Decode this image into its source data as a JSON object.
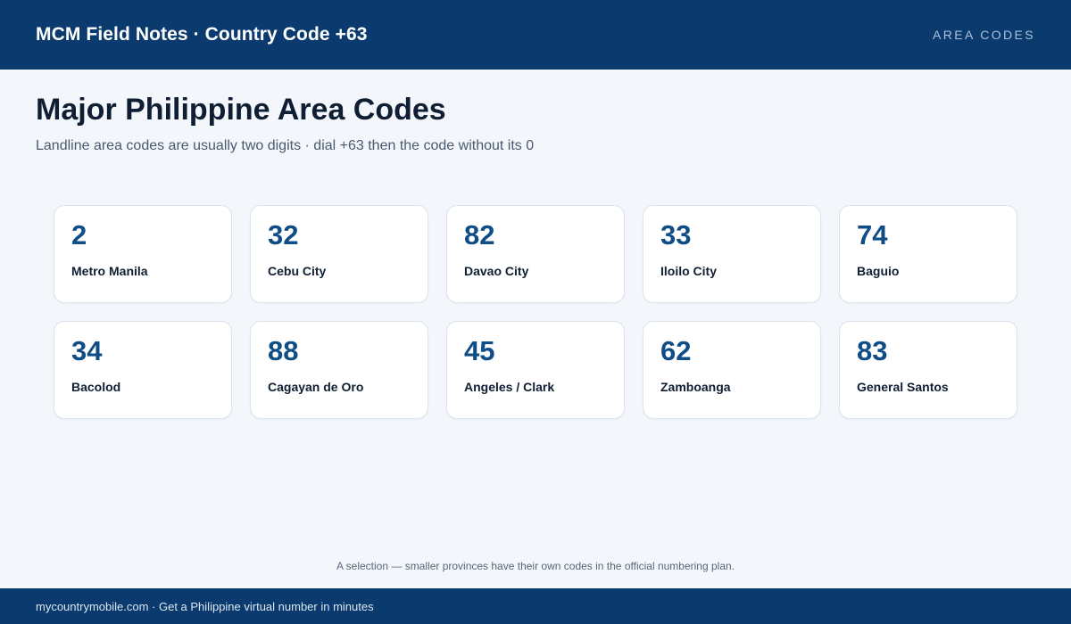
{
  "header": {
    "brand": "MCM Field Notes · Country Code +63",
    "section": "AREA CODES"
  },
  "main": {
    "title": "Major Philippine Area Codes",
    "subtitle": "Landline area codes are usually two digits · dial +63 then the code without its 0",
    "cards": [
      {
        "code": "2",
        "city": "Metro Manila"
      },
      {
        "code": "32",
        "city": "Cebu City"
      },
      {
        "code": "82",
        "city": "Davao City"
      },
      {
        "code": "33",
        "city": "Iloilo City"
      },
      {
        "code": "74",
        "city": "Baguio"
      },
      {
        "code": "34",
        "city": "Bacolod"
      },
      {
        "code": "88",
        "city": "Cagayan de Oro"
      },
      {
        "code": "45",
        "city": "Angeles / Clark"
      },
      {
        "code": "62",
        "city": "Zamboanga"
      },
      {
        "code": "83",
        "city": "General Santos"
      }
    ],
    "footnote": "A selection — smaller provinces have their own codes in the official numbering plan."
  },
  "footer": {
    "text": "mycountrymobile.com · Get a Philippine virtual number in minutes"
  },
  "colors": {
    "brand_bar": "#0b3b6e",
    "accent_code": "#0f4d86",
    "background": "#f3f7fb"
  }
}
